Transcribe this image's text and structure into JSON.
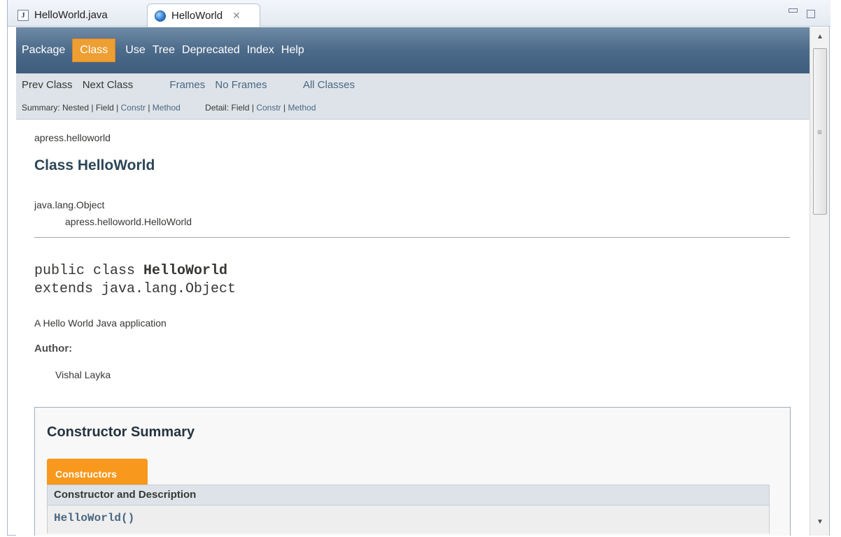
{
  "tabs": [
    {
      "label": "HelloWorld.java",
      "icon": "java-file-icon"
    },
    {
      "label": "HelloWorld",
      "icon": "globe-icon",
      "active": true
    }
  ],
  "topnav": [
    "Package",
    "Class",
    "Use",
    "Tree",
    "Deprecated",
    "Index",
    "Help"
  ],
  "subnav": {
    "prev": "Prev Class",
    "next": "Next Class",
    "frames": "Frames",
    "noframes": "No Frames",
    "allclasses": "All Classes",
    "summary_label": "Summary: Nested | Field |",
    "constr": "Constr",
    "sep1": "|",
    "method": "Method",
    "detail_label": "Detail: Field |",
    "detail_constr": "Constr",
    "sep2": "|",
    "detail_method": "Method"
  },
  "page": {
    "package": "apress.helloworld",
    "title": "Class HelloWorld",
    "inherit_root": "java.lang.Object",
    "inherit_child": "apress.helloworld.HelloWorld",
    "decl_prefix": "public class ",
    "decl_name": "HelloWorld",
    "decl_extends": "extends java.lang.Object",
    "description": "A Hello World Java application",
    "author_label": "Author:",
    "author_name": "Vishal Layka"
  },
  "summary": {
    "title": "Constructor Summary",
    "tab": "Constructors",
    "header": "Constructor and Description",
    "row": "HelloWorld()"
  },
  "colors": {
    "nav_bg": "#4c6b8a",
    "active_orange": "#ee9f33",
    "link": "#4a6782"
  }
}
